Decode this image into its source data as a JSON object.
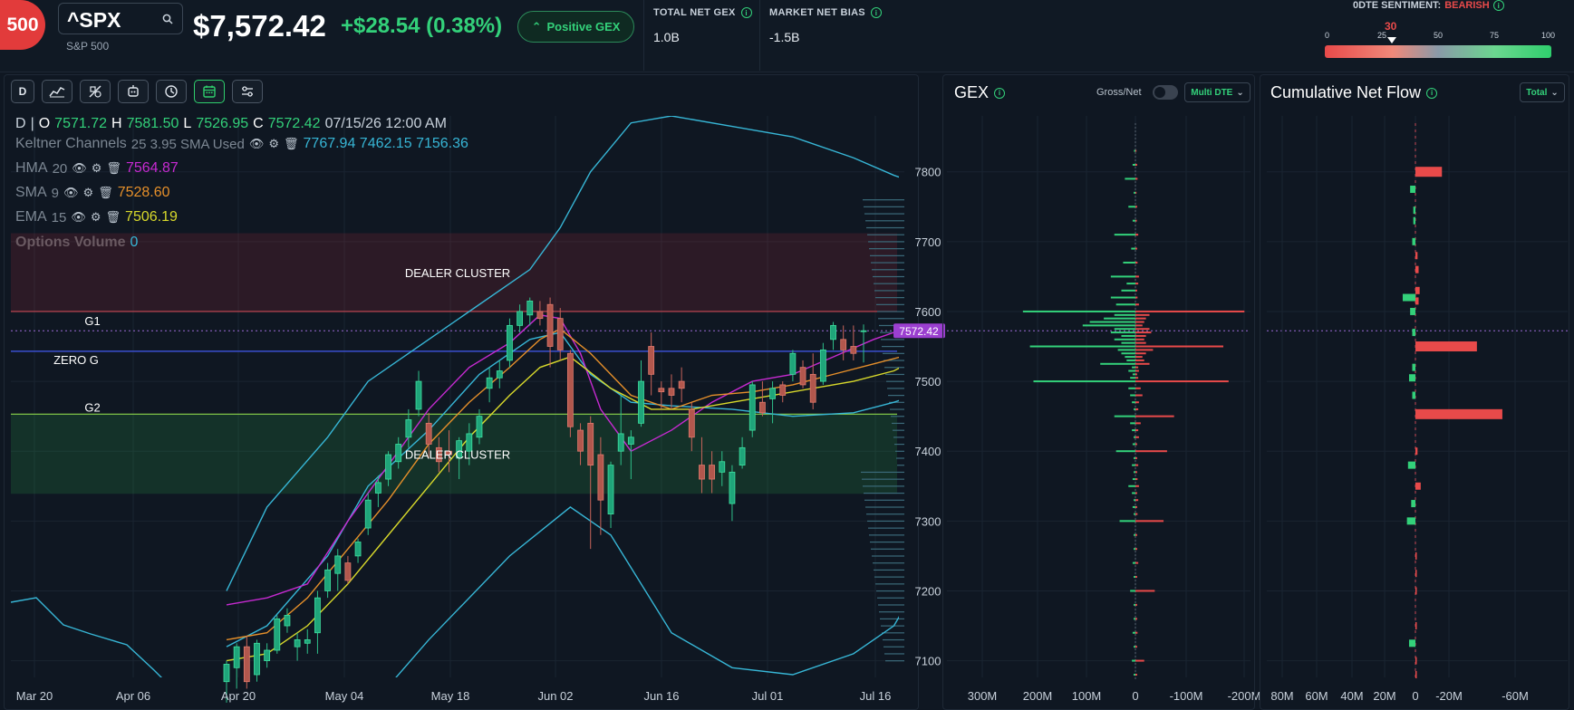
{
  "header": {
    "logo_text": "500",
    "symbol": "^SPX",
    "symbol_name": "S&P 500",
    "price": "$7,572.42",
    "change": "+$28.54 (0.38%)",
    "gex_pill": "Positive GEX",
    "total_net_gex_label": "TOTAL NET GEX",
    "total_net_gex_value": "1.0B",
    "market_net_bias_label": "MARKET NET BIAS",
    "market_net_bias_value": "-1.5B",
    "sentiment_label": "0DTE SENTIMENT:",
    "sentiment_value": "BEARISH",
    "sentiment_score": "30",
    "sentiment_ticks": [
      "0",
      "25",
      "50",
      "75",
      "100"
    ],
    "colors": {
      "up": "#33d17a",
      "down": "#e84a4a",
      "accent": "#2fcf6d"
    }
  },
  "toolbar": {
    "items": [
      {
        "label": "D",
        "icon": "timeframe"
      },
      {
        "label": "",
        "icon": "line-chart-icon"
      },
      {
        "label": "",
        "icon": "drawing-tools-icon"
      },
      {
        "label": "",
        "icon": "bot-icon"
      },
      {
        "label": "",
        "icon": "history-icon"
      },
      {
        "label": "",
        "icon": "calendar-icon"
      },
      {
        "label": "",
        "icon": "settings-sliders-icon"
      }
    ]
  },
  "indicators": {
    "ohlc_tf": "D",
    "ohlc_o_label": "O",
    "ohlc_o": "7571.72",
    "ohlc_h_label": "H",
    "ohlc_h": "7581.50",
    "ohlc_l_label": "L",
    "ohlc_l": "7526.95",
    "ohlc_c_label": "C",
    "ohlc_c": "7572.42",
    "ohlc_date": "07/15/26 12:00 AM",
    "keltner_name": "Keltner Channels",
    "keltner_params": "25 3.95 SMA Used",
    "keltner_values": "7767.94 7462.15 7156.36",
    "hma_name": "HMA",
    "hma_param": "20",
    "hma_value": "7564.87",
    "sma_name": "SMA",
    "sma_param": "9",
    "sma_value": "7528.60",
    "ema_name": "EMA",
    "ema_param": "15",
    "ema_value": "7506.19",
    "options_volume_name": "Options Volume",
    "options_volume_value": "0"
  },
  "chart_labels": {
    "dealer_cluster_top": "DEALER CLUSTER",
    "dealer_cluster_bottom": "DEALER CLUSTER",
    "g1": "G1",
    "zero_g": "ZERO G",
    "g2": "G2",
    "price_tag": "7572.42"
  },
  "gex_panel": {
    "title": "GEX",
    "toggle_label": "Gross/Net",
    "dropdown": "Multi DTE",
    "x_ticks": [
      "300M",
      "200M",
      "100M",
      "0",
      "-100M",
      "-200M"
    ]
  },
  "flow_panel": {
    "title": "Cumulative Net Flow",
    "dropdown": "Total",
    "x_ticks": [
      "80M",
      "60M",
      "40M",
      "20M",
      "0",
      "-20M",
      "-60M"
    ]
  },
  "chart_data": {
    "type": "candlestick",
    "x_ticks": [
      "Mar 20",
      "Apr 06",
      "Apr 20",
      "May 04",
      "May 18",
      "Jun 02",
      "Jun 16",
      "Jul 01",
      "Jul 16"
    ],
    "y_ticks": [
      "7800",
      "7700",
      "7600",
      "7500",
      "7400",
      "7300",
      "7200",
      "7100"
    ],
    "ylim": [
      7045,
      7880
    ],
    "levels": {
      "g1": 7600,
      "zero_g": 7543,
      "g2": 7453,
      "last_price": 7572.42
    },
    "zones": [
      {
        "from": 7600,
        "to": 7712
      },
      {
        "from": 7339,
        "to": 7453
      }
    ],
    "candles": [
      {
        "o": 7070,
        "h": 7100,
        "l": 7040,
        "c": 7095
      },
      {
        "o": 7090,
        "h": 7125,
        "l": 7060,
        "c": 7120
      },
      {
        "o": 7120,
        "h": 7135,
        "l": 7060,
        "c": 7070
      },
      {
        "o": 7080,
        "h": 7130,
        "l": 7070,
        "c": 7125
      },
      {
        "o": 7100,
        "h": 7125,
        "l": 7090,
        "c": 7115
      },
      {
        "o": 7115,
        "h": 7165,
        "l": 7110,
        "c": 7160
      },
      {
        "o": 7150,
        "h": 7175,
        "l": 7140,
        "c": 7165
      },
      {
        "o": 7120,
        "h": 7140,
        "l": 7100,
        "c": 7130
      },
      {
        "o": 7125,
        "h": 7145,
        "l": 7110,
        "c": 7130
      },
      {
        "o": 7140,
        "h": 7200,
        "l": 7110,
        "c": 7190
      },
      {
        "o": 7200,
        "h": 7240,
        "l": 7190,
        "c": 7230
      },
      {
        "o": 7225,
        "h": 7260,
        "l": 7200,
        "c": 7250
      },
      {
        "o": 7240,
        "h": 7250,
        "l": 7210,
        "c": 7215
      },
      {
        "o": 7250,
        "h": 7275,
        "l": 7240,
        "c": 7270
      },
      {
        "o": 7290,
        "h": 7340,
        "l": 7280,
        "c": 7330
      },
      {
        "o": 7340,
        "h": 7365,
        "l": 7320,
        "c": 7355
      },
      {
        "o": 7360,
        "h": 7400,
        "l": 7350,
        "c": 7395
      },
      {
        "o": 7385,
        "h": 7420,
        "l": 7375,
        "c": 7410
      },
      {
        "o": 7420,
        "h": 7460,
        "l": 7405,
        "c": 7445
      },
      {
        "o": 7460,
        "h": 7515,
        "l": 7450,
        "c": 7500
      },
      {
        "o": 7440,
        "h": 7455,
        "l": 7390,
        "c": 7410
      },
      {
        "o": 7405,
        "h": 7420,
        "l": 7370,
        "c": 7385
      },
      {
        "o": 7400,
        "h": 7430,
        "l": 7370,
        "c": 7395
      },
      {
        "o": 7390,
        "h": 7420,
        "l": 7360,
        "c": 7415
      },
      {
        "o": 7400,
        "h": 7440,
        "l": 7380,
        "c": 7425
      },
      {
        "o": 7420,
        "h": 7460,
        "l": 7410,
        "c": 7450
      },
      {
        "o": 7490,
        "h": 7520,
        "l": 7470,
        "c": 7505
      },
      {
        "o": 7505,
        "h": 7530,
        "l": 7490,
        "c": 7515
      },
      {
        "o": 7530,
        "h": 7590,
        "l": 7520,
        "c": 7580
      },
      {
        "o": 7580,
        "h": 7610,
        "l": 7570,
        "c": 7600
      },
      {
        "o": 7595,
        "h": 7620,
        "l": 7580,
        "c": 7615
      },
      {
        "o": 7600,
        "h": 7615,
        "l": 7580,
        "c": 7590
      },
      {
        "o": 7610,
        "h": 7620,
        "l": 7520,
        "c": 7550
      },
      {
        "o": 7590,
        "h": 7605,
        "l": 7530,
        "c": 7545
      },
      {
        "o": 7540,
        "h": 7545,
        "l": 7420,
        "c": 7435
      },
      {
        "o": 7430,
        "h": 7440,
        "l": 7380,
        "c": 7400
      },
      {
        "o": 7440,
        "h": 7450,
        "l": 7260,
        "c": 7380
      },
      {
        "o": 7395,
        "h": 7420,
        "l": 7280,
        "c": 7330
      },
      {
        "o": 7310,
        "h": 7385,
        "l": 7290,
        "c": 7380
      },
      {
        "o": 7400,
        "h": 7480,
        "l": 7380,
        "c": 7425
      },
      {
        "o": 7410,
        "h": 7430,
        "l": 7360,
        "c": 7420
      },
      {
        "o": 7440,
        "h": 7530,
        "l": 7435,
        "c": 7500
      },
      {
        "o": 7550,
        "h": 7570,
        "l": 7480,
        "c": 7510
      },
      {
        "o": 7490,
        "h": 7500,
        "l": 7460,
        "c": 7485
      },
      {
        "o": 7490,
        "h": 7510,
        "l": 7460,
        "c": 7480
      },
      {
        "o": 7500,
        "h": 7520,
        "l": 7470,
        "c": 7490
      },
      {
        "o": 7460,
        "h": 7470,
        "l": 7400,
        "c": 7420
      },
      {
        "o": 7380,
        "h": 7420,
        "l": 7340,
        "c": 7360
      },
      {
        "o": 7380,
        "h": 7400,
        "l": 7340,
        "c": 7360
      },
      {
        "o": 7370,
        "h": 7400,
        "l": 7350,
        "c": 7385
      },
      {
        "o": 7325,
        "h": 7380,
        "l": 7300,
        "c": 7370
      },
      {
        "o": 7380,
        "h": 7420,
        "l": 7375,
        "c": 7405
      },
      {
        "o": 7430,
        "h": 7500,
        "l": 7420,
        "c": 7495
      },
      {
        "o": 7470,
        "h": 7500,
        "l": 7450,
        "c": 7455
      },
      {
        "o": 7475,
        "h": 7500,
        "l": 7440,
        "c": 7490
      },
      {
        "o": 7495,
        "h": 7500,
        "l": 7470,
        "c": 7480
      },
      {
        "o": 7510,
        "h": 7545,
        "l": 7500,
        "c": 7540
      },
      {
        "o": 7520,
        "h": 7530,
        "l": 7490,
        "c": 7495
      },
      {
        "o": 7510,
        "h": 7540,
        "l": 7460,
        "c": 7470
      },
      {
        "o": 7500,
        "h": 7555,
        "l": 7495,
        "c": 7545
      },
      {
        "o": 7560,
        "h": 7585,
        "l": 7545,
        "c": 7580
      },
      {
        "o": 7560,
        "h": 7580,
        "l": 7530,
        "c": 7545
      },
      {
        "o": 7550,
        "h": 7580,
        "l": 7530,
        "c": 7540
      },
      {
        "o": 7571.72,
        "h": 7581.5,
        "l": 7526.95,
        "c": 7572.42
      }
    ],
    "overlays": {
      "keltner_upper": [
        [
          0,
          7200
        ],
        [
          4,
          7320
        ],
        [
          10,
          7420
        ],
        [
          14,
          7500
        ],
        [
          20,
          7560
        ],
        [
          25,
          7610
        ],
        [
          30,
          7660
        ],
        [
          33,
          7720
        ],
        [
          36,
          7800
        ],
        [
          40,
          7870
        ],
        [
          44,
          7880
        ],
        [
          50,
          7865
        ],
        [
          56,
          7850
        ],
        [
          62,
          7820
        ],
        [
          66,
          7795
        ],
        [
          68,
          7785
        ]
      ],
      "keltner_mid": [
        [
          0,
          7120
        ],
        [
          4,
          7150
        ],
        [
          10,
          7250
        ],
        [
          14,
          7350
        ],
        [
          20,
          7430
        ],
        [
          25,
          7510
        ],
        [
          30,
          7560
        ],
        [
          33,
          7570
        ],
        [
          36,
          7510
        ],
        [
          40,
          7470
        ],
        [
          44,
          7465
        ],
        [
          50,
          7460
        ],
        [
          56,
          7450
        ],
        [
          62,
          7455
        ],
        [
          66,
          7470
        ],
        [
          68,
          7480
        ]
      ],
      "keltner_lower": [
        [
          0,
          7050
        ],
        [
          6,
          7000
        ],
        [
          14,
          7030
        ],
        [
          20,
          7130
        ],
        [
          28,
          7250
        ],
        [
          34,
          7320
        ],
        [
          38,
          7280
        ],
        [
          44,
          7140
        ],
        [
          50,
          7090
        ],
        [
          56,
          7080
        ],
        [
          62,
          7110
        ],
        [
          66,
          7150
        ],
        [
          68,
          7200
        ]
      ],
      "hma": [
        [
          0,
          7180
        ],
        [
          4,
          7190
        ],
        [
          8,
          7210
        ],
        [
          12,
          7300
        ],
        [
          16,
          7380
        ],
        [
          20,
          7460
        ],
        [
          24,
          7520
        ],
        [
          28,
          7555
        ],
        [
          31,
          7595
        ],
        [
          33,
          7590
        ],
        [
          35,
          7540
        ],
        [
          37,
          7460
        ],
        [
          40,
          7400
        ],
        [
          44,
          7430
        ],
        [
          48,
          7470
        ],
        [
          52,
          7500
        ],
        [
          56,
          7510
        ],
        [
          60,
          7535
        ],
        [
          64,
          7560
        ],
        [
          68,
          7580
        ]
      ],
      "sma": [
        [
          0,
          7130
        ],
        [
          4,
          7140
        ],
        [
          8,
          7190
        ],
        [
          12,
          7260
        ],
        [
          16,
          7330
        ],
        [
          20,
          7410
        ],
        [
          24,
          7470
        ],
        [
          28,
          7520
        ],
        [
          31,
          7560
        ],
        [
          33,
          7575
        ],
        [
          36,
          7540
        ],
        [
          40,
          7480
        ],
        [
          44,
          7460
        ],
        [
          48,
          7480
        ],
        [
          52,
          7485
        ],
        [
          56,
          7495
        ],
        [
          60,
          7510
        ],
        [
          64,
          7525
        ],
        [
          68,
          7540
        ]
      ],
      "ema": [
        [
          0,
          7100
        ],
        [
          4,
          7110
        ],
        [
          8,
          7150
        ],
        [
          12,
          7210
        ],
        [
          16,
          7280
        ],
        [
          20,
          7350
        ],
        [
          24,
          7420
        ],
        [
          28,
          7480
        ],
        [
          31,
          7520
        ],
        [
          34,
          7535
        ],
        [
          38,
          7490
        ],
        [
          42,
          7460
        ],
        [
          46,
          7460
        ],
        [
          50,
          7470
        ],
        [
          54,
          7480
        ],
        [
          58,
          7490
        ],
        [
          62,
          7500
        ],
        [
          66,
          7515
        ],
        [
          68,
          7530
        ]
      ]
    }
  },
  "gex_chart_data": {
    "type": "bar",
    "orientation": "horizontal",
    "unit": "M",
    "strikes": [
      7830,
      7810,
      7790,
      7770,
      7750,
      7730,
      7710,
      7690,
      7670,
      7650,
      7640,
      7630,
      7620,
      7610,
      7600,
      7595,
      7590,
      7585,
      7580,
      7575,
      7570,
      7565,
      7560,
      7555,
      7550,
      7545,
      7540,
      7535,
      7530,
      7525,
      7520,
      7515,
      7510,
      7505,
      7500,
      7490,
      7480,
      7470,
      7460,
      7450,
      7440,
      7430,
      7420,
      7410,
      7400,
      7390,
      7380,
      7370,
      7360,
      7350,
      7340,
      7330,
      7320,
      7310,
      7300,
      7280,
      7260,
      7240,
      7220,
      7200,
      7180,
      7160,
      7140,
      7120,
      7100,
      7080
    ],
    "positive": [
      4,
      8,
      30,
      5,
      20,
      8,
      60,
      12,
      35,
      70,
      25,
      40,
      70,
      55,
      320,
      60,
      90,
      130,
      150,
      60,
      70,
      40,
      60,
      40,
      300,
      50,
      40,
      30,
      25,
      100,
      10,
      20,
      8,
      15,
      290,
      20,
      15,
      10,
      5,
      60,
      15,
      10,
      5,
      8,
      55,
      5,
      10,
      5,
      8,
      20,
      10,
      5,
      8,
      5,
      45,
      5,
      5,
      8,
      5,
      15,
      5,
      5,
      8,
      5,
      10,
      5
    ],
    "negative": [
      3,
      5,
      6,
      3,
      5,
      4,
      8,
      5,
      6,
      10,
      8,
      5,
      6,
      10,
      310,
      40,
      30,
      25,
      20,
      40,
      45,
      30,
      25,
      30,
      250,
      50,
      30,
      20,
      25,
      40,
      8,
      10,
      5,
      8,
      265,
      15,
      20,
      10,
      8,
      110,
      15,
      8,
      10,
      5,
      90,
      5,
      8,
      5,
      6,
      10,
      5,
      8,
      5,
      6,
      80,
      5,
      5,
      8,
      5,
      55,
      5,
      5,
      6,
      5,
      25,
      5
    ]
  },
  "flow_chart_data": {
    "type": "bar",
    "orientation": "horizontal",
    "unit": "M",
    "bars": [
      {
        "price": 7775,
        "value": 5
      },
      {
        "price": 7800,
        "value": -25
      },
      {
        "price": 7745,
        "value": 2
      },
      {
        "price": 7730,
        "value": 2
      },
      {
        "price": 7700,
        "value": 3
      },
      {
        "price": 7680,
        "value": -2
      },
      {
        "price": 7660,
        "value": -3
      },
      {
        "price": 7630,
        "value": -4
      },
      {
        "price": 7620,
        "value": 12
      },
      {
        "price": 7615,
        "value": -3
      },
      {
        "price": 7600,
        "value": 5
      },
      {
        "price": 7570,
        "value": 3
      },
      {
        "price": 7550,
        "value": -58
      },
      {
        "price": 7520,
        "value": 3
      },
      {
        "price": 7505,
        "value": 6
      },
      {
        "price": 7480,
        "value": 3
      },
      {
        "price": 7453,
        "value": -82
      },
      {
        "price": 7400,
        "value": -2
      },
      {
        "price": 7380,
        "value": 7
      },
      {
        "price": 7350,
        "value": -5
      },
      {
        "price": 7325,
        "value": 4
      },
      {
        "price": 7300,
        "value": 8
      },
      {
        "price": 7250,
        "value": -1
      },
      {
        "price": 7225,
        "value": -1
      },
      {
        "price": 7200,
        "value": -1
      },
      {
        "price": 7150,
        "value": -1
      },
      {
        "price": 7125,
        "value": 6
      },
      {
        "price": 7100,
        "value": -1
      },
      {
        "price": 7080,
        "value": -1
      }
    ]
  }
}
